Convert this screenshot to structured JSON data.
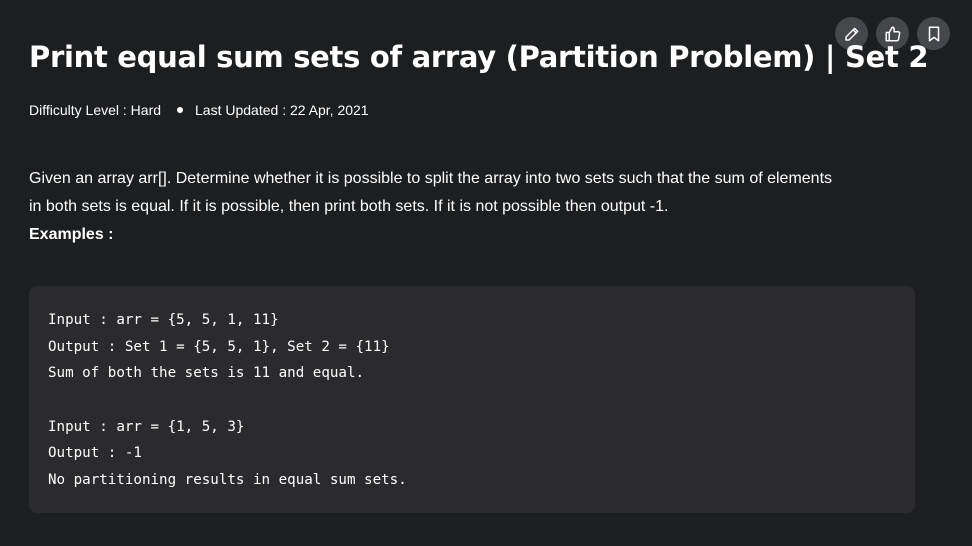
{
  "article": {
    "title": "Print equal sum sets of array (Partition Problem) | Set 2",
    "difficulty": "Difficulty Level : Hard",
    "last_updated": "Last Updated : 22 Apr, 2021",
    "description_line1": "Given an array arr[]. Determine whether it is possible to split the array into two sets such that the sum of elements",
    "description_line2": "in both sets is equal. If it is possible, then print both sets. If it is not possible then output -1.",
    "examples_label": "Examples :",
    "code_lines": [
      "Input : arr = {5, 5, 1, 11}",
      "Output : Set 1 = {5, 5, 1}, Set 2 = {11}",
      "Sum of both the sets is 11 and equal.",
      "",
      "Input : arr = {1, 5, 3}",
      "Output : -1",
      "No partitioning results in equal sum sets."
    ]
  },
  "actions": {
    "icons": [
      "pencil-icon",
      "thumbs-up-icon",
      "bookmark-icon"
    ]
  }
}
